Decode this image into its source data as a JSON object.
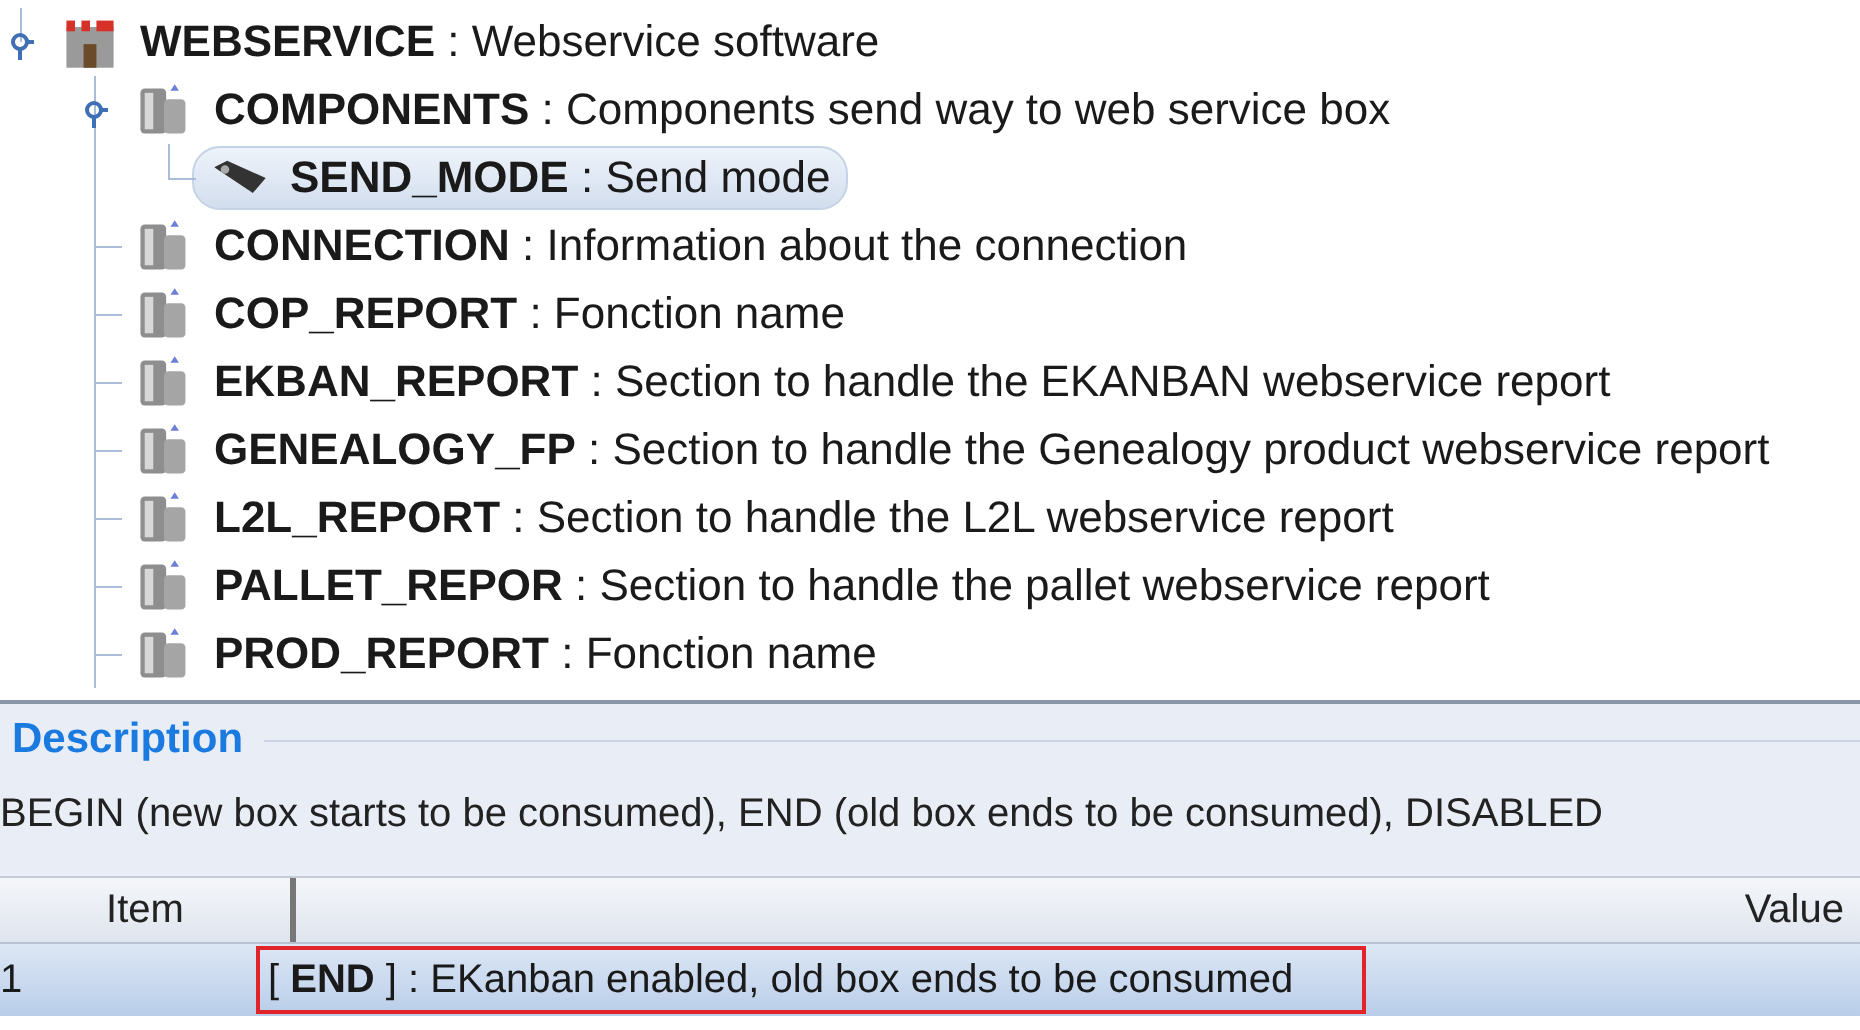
{
  "tree": [
    {
      "kind": "castle",
      "label": "**WEBSERVICE** : Webservice software",
      "expanded": true,
      "selected": false,
      "children": [
        {
          "kind": "server",
          "label": "**COMPONENTS** : Components send way to web service box",
          "expanded": true,
          "selected": false,
          "children": [
            {
              "kind": "tag",
              "label": "**SEND_MODE** : Send mode",
              "selected": true
            }
          ]
        },
        {
          "kind": "server",
          "label": "**CONNECTION** : Information about the connection",
          "selected": false
        },
        {
          "kind": "server",
          "label": "**COP_REPORT** : Fonction name",
          "selected": false
        },
        {
          "kind": "server",
          "label": "**EKBAN_REPORT** : Section to handle the EKANBAN webservice report",
          "selected": false
        },
        {
          "kind": "server",
          "label": "**GENEALOGY_FP** : Section to handle the Genealogy product webservice report",
          "selected": false
        },
        {
          "kind": "server",
          "label": "**L2L_REPORT** : Section to handle the L2L webservice report",
          "selected": false
        },
        {
          "kind": "server",
          "label": "**PALLET_REPOR** : Section to handle the pallet webservice report",
          "selected": false
        },
        {
          "kind": "server",
          "label": "**PROD_REPORT** : Fonction name",
          "selected": false
        }
      ]
    }
  ],
  "description": {
    "title": "Description",
    "text": "BEGIN (new box starts to be consumed), END (old box ends to be consumed), DISABLED"
  },
  "table": {
    "columns": [
      "Item",
      "Value"
    ],
    "rows": [
      {
        "item": "1",
        "value": "[ **END** ] : EKanban enabled, old box ends to be consumed",
        "highlighted": true
      }
    ]
  }
}
